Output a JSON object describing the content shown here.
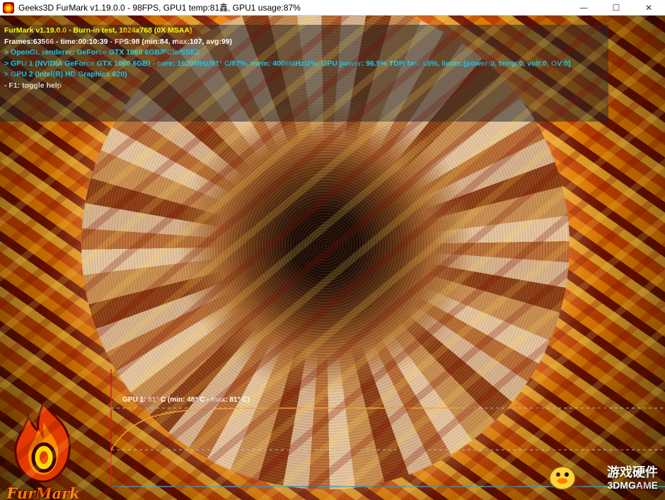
{
  "window": {
    "title": "Geeks3D FurMark v1.19.0.0 - 98FPS, GPU1 temp:81鑫, GPU1 usage:87%",
    "buttons": {
      "minimize": "—",
      "maximize": "☐",
      "close": "✕"
    }
  },
  "hud": {
    "title_line": "FurMark v1.19.0.0 - Burn-in test, 1024x768 (0X MSAA)",
    "frames_line": "Frames:63566 - time:00:10:39 - FPS:98 (min:84, max:107, avg:99)",
    "renderer_line": "> OpenGL renderer: GeForce GTX 1060 6GB/PCIe/SSE2",
    "gpu1_line": "> GPU 1 (NVIDIA GeForce GTX 1060 6GB) - core: 1620MHz/81° C/87%, mem: 4006MHz/2%, GPU power: 96.5% TDP, fan: 65%, limits:[power:0, temp:0, volt:0, OV:0]",
    "gpu2_line": "> GPU 2 (Intel(R) HD Graphics 620)",
    "help_line": "- F1: toggle help",
    "colors": {
      "title": "#ffff00",
      "info": "#19c8e6",
      "text": "#ffffff"
    }
  },
  "temp_graph": {
    "label": "GPU 1: 81° C (min: 48° C - max: 81° C)",
    "current_c": 81,
    "min_c": 48,
    "max_c": 81,
    "line_color": "#f0a030",
    "axis_color": "#1fa0d0"
  },
  "logo": {
    "text": "FurMark",
    "icon": "flame-logo-icon"
  },
  "watermark": {
    "line1": "游戏硬件",
    "line2": "3DMGAME",
    "icon": "duck-mascot-icon"
  }
}
